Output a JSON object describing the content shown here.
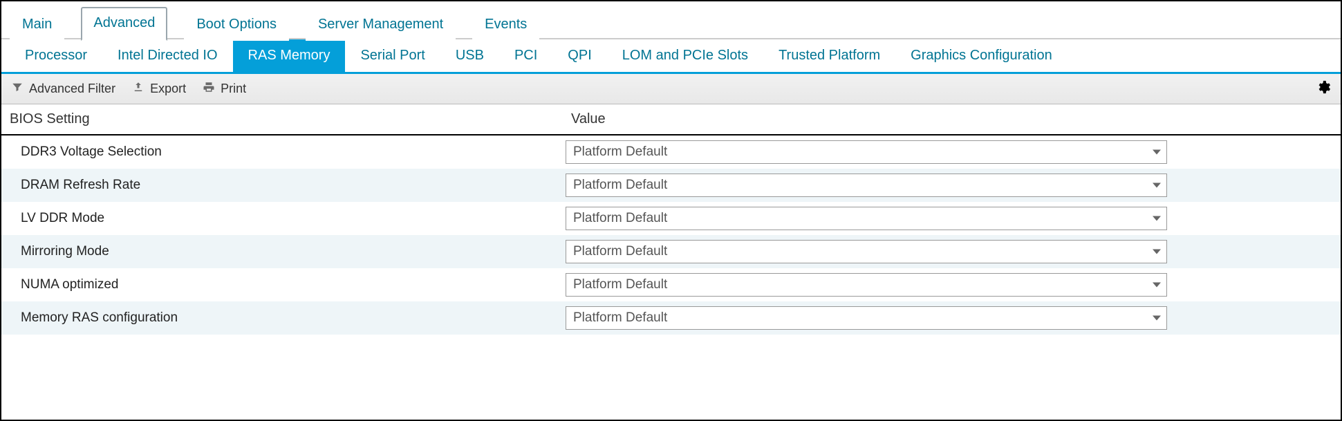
{
  "topTabs": [
    {
      "label": "Main"
    },
    {
      "label": "Advanced"
    },
    {
      "label": "Boot Options"
    },
    {
      "label": "Server Management"
    },
    {
      "label": "Events"
    }
  ],
  "topActiveIndex": 1,
  "subTabs": [
    {
      "label": "Processor"
    },
    {
      "label": "Intel Directed IO"
    },
    {
      "label": "RAS Memory"
    },
    {
      "label": "Serial Port"
    },
    {
      "label": "USB"
    },
    {
      "label": "PCI"
    },
    {
      "label": "QPI"
    },
    {
      "label": "LOM and PCIe Slots"
    },
    {
      "label": "Trusted Platform"
    },
    {
      "label": "Graphics Configuration"
    }
  ],
  "subActiveIndex": 2,
  "toolbar": {
    "advancedFilter": "Advanced Filter",
    "export": "Export",
    "print": "Print"
  },
  "columns": {
    "setting": "BIOS Setting",
    "value": "Value"
  },
  "rows": [
    {
      "label": "DDR3 Voltage Selection",
      "value": "Platform Default"
    },
    {
      "label": "DRAM Refresh Rate",
      "value": "Platform Default"
    },
    {
      "label": "LV DDR Mode",
      "value": "Platform Default"
    },
    {
      "label": "Mirroring Mode",
      "value": "Platform Default"
    },
    {
      "label": "NUMA optimized",
      "value": "Platform Default"
    },
    {
      "label": "Memory RAS configuration",
      "value": "Platform Default"
    }
  ]
}
